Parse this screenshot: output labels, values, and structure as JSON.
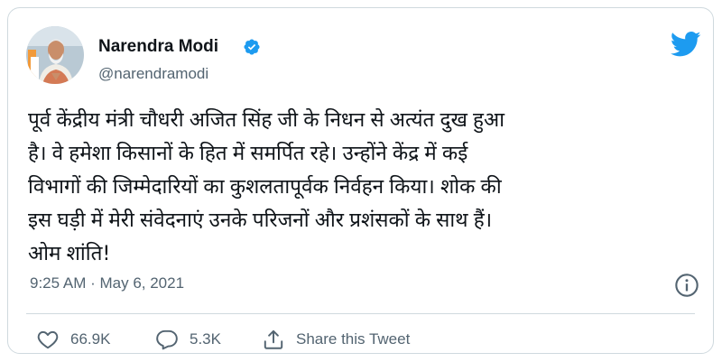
{
  "author": {
    "name": "Narendra Modi",
    "handle": "@narendramodi",
    "verified_icon": "verified-badge-icon",
    "platform_icon": "twitter-bird-icon"
  },
  "tweet": {
    "text_lines": [
      "पूर्व केंद्रीय मंत्री चौधरी अजित सिंह जी के निधन से अत्यंत दुख हुआ",
      "है। वे हमेशा किसानों के हित में समर्पित रहे। उन्होंने केंद्र में कई",
      "विभागों की जिम्मेदारियों का कुशलतापूर्वक निर्वहन किया। शोक की",
      "इस घड़ी में मेरी संवेदनाएं उनके परिजनों और प्रशंसकों के साथ हैं।",
      "ओम शांति!"
    ],
    "timestamp": "9:25 AM · May 6, 2021"
  },
  "actions": {
    "likes": "66.9K",
    "replies": "5.3K",
    "share_label": "Share this Tweet"
  },
  "colors": {
    "brand": "#1d9bf0",
    "text": "#0f1419",
    "secondary": "#536471",
    "border": "#cfd9de"
  }
}
